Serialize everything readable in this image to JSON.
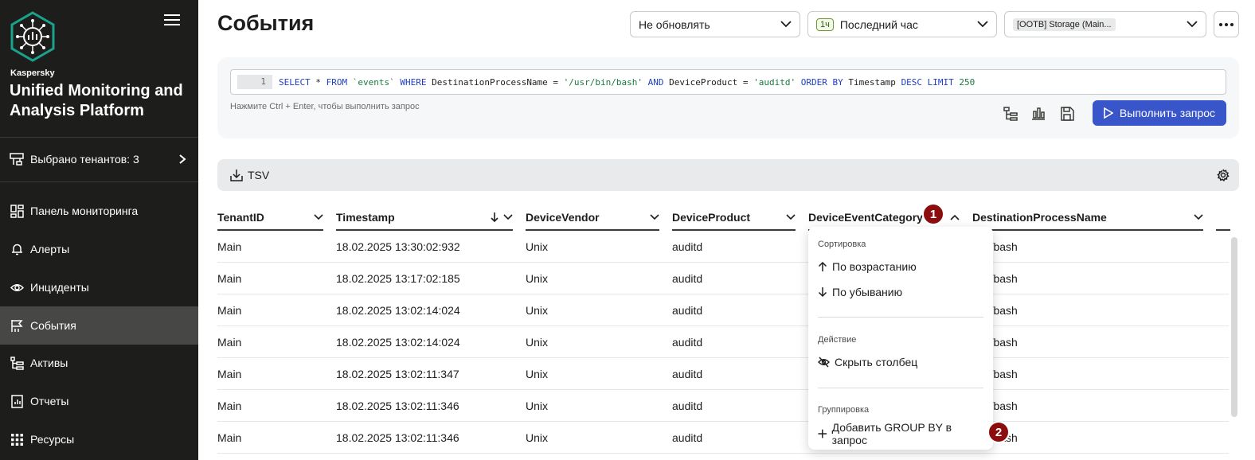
{
  "sidebar": {
    "brand_small": "Kaspersky",
    "brand_title": "Unified Monitoring and Analysis Platform",
    "tenants_label": "Выбрано тенантов: 3",
    "items": [
      {
        "label": "Панель мониторинга",
        "icon": "dashboard-icon"
      },
      {
        "label": "Алерты",
        "icon": "bell-icon"
      },
      {
        "label": "Инциденты",
        "icon": "eye-icon"
      },
      {
        "label": "События",
        "icon": "flag-icon"
      },
      {
        "label": "Активы",
        "icon": "assets-tree-icon"
      },
      {
        "label": "Отчеты",
        "icon": "report-icon"
      },
      {
        "label": "Ресурсы",
        "icon": "grid-dots-icon"
      }
    ],
    "active_index": 3
  },
  "header": {
    "title": "События",
    "refresh_select": "Не обновлять",
    "period_badge": "1ч",
    "period_select": "Последний час",
    "storage_select": "[OOTB] Storage (Main..."
  },
  "query": {
    "line_number": "1",
    "hint": "Нажмите Ctrl + Enter, чтобы выполнить запрос",
    "run_label": "Выполнить запрос"
  },
  "result_bar": {
    "export_label": "TSV"
  },
  "table": {
    "columns": [
      "TenantID",
      "Timestamp",
      "DeviceVendor",
      "DeviceProduct",
      "DeviceEventCategory",
      "DestinationProcessName"
    ],
    "rows": [
      [
        "Main",
        "18.02.2025 13:30:02:932",
        "Unix",
        "auditd",
        "",
        "/bin/bash"
      ],
      [
        "Main",
        "18.02.2025 13:17:02:185",
        "Unix",
        "auditd",
        "",
        "/bin/bash"
      ],
      [
        "Main",
        "18.02.2025 13:02:14:024",
        "Unix",
        "auditd",
        "",
        "/bin/bash"
      ],
      [
        "Main",
        "18.02.2025 13:02:14:024",
        "Unix",
        "auditd",
        "",
        "/bin/bash"
      ],
      [
        "Main",
        "18.02.2025 13:02:11:347",
        "Unix",
        "auditd",
        "",
        "/bin/bash"
      ],
      [
        "Main",
        "18.02.2025 13:02:11:346",
        "Unix",
        "auditd",
        "",
        "/bin/bash"
      ],
      [
        "Main",
        "18.02.2025 13:02:11:346",
        "Unix",
        "auditd",
        "",
        "/bin/bash"
      ]
    ]
  },
  "column_menu": {
    "sort_section": "Сортировка",
    "sort_asc": "По возрастанию",
    "sort_desc": "По убыванию",
    "action_section": "Действие",
    "hide_column": "Скрыть столбец",
    "group_section": "Группировка",
    "add_group_by": "Добавить GROUP BY в запрос"
  },
  "callouts": [
    "1",
    "2"
  ],
  "colors": {
    "sidebar_bg": "#1d1d1b",
    "sidebar_active": "#474745",
    "accent_button": "#3856c9",
    "callout": "#8b0d0d",
    "logo_teal": "#1aa38c"
  }
}
